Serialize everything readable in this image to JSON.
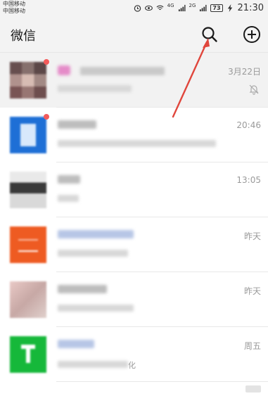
{
  "status_bar": {
    "carrier_1": "中国移动",
    "carrier_2": "中国移动",
    "net_1": "4G",
    "net_2": "2G",
    "battery": "73",
    "time": "21:30"
  },
  "header": {
    "title": "微信",
    "search_icon": "search-icon",
    "add_icon": "plus-circle-icon"
  },
  "chats": [
    {
      "name": "",
      "preview": "",
      "time": "3月22日",
      "muted": true,
      "unread_dot": true,
      "avatar": "avatar-collage"
    },
    {
      "name": "",
      "preview": "",
      "time": "20:46",
      "muted": false,
      "unread_dot": true,
      "avatar": "avatar-blue-app"
    },
    {
      "name": "",
      "preview": "",
      "time": "13:05",
      "muted": false,
      "unread_dot": false,
      "avatar": "avatar-person"
    },
    {
      "name": "",
      "preview": "",
      "time": "昨天",
      "muted": false,
      "unread_dot": false,
      "avatar": "avatar-orange-app"
    },
    {
      "name": "",
      "preview": "",
      "time": "昨天",
      "muted": false,
      "unread_dot": false,
      "avatar": "avatar-photo"
    },
    {
      "name": "",
      "preview": "化",
      "time": "周五",
      "muted": false,
      "unread_dot": false,
      "avatar": "avatar-green-app"
    }
  ],
  "colors": {
    "header_bg": "#f3f3f3",
    "pinned_bg": "#f2f2f2",
    "unread_dot": "#f25b5b",
    "annotation_arrow": "#e0463c"
  }
}
